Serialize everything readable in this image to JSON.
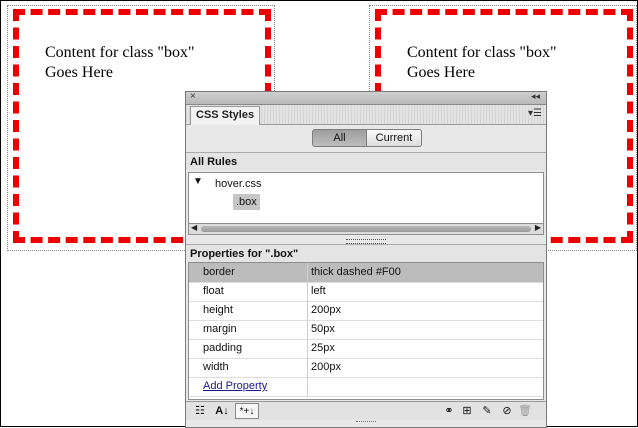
{
  "boxes": [
    {
      "line1": "Content for class \"box\"",
      "line2": "Goes Here"
    },
    {
      "line1": "Content for class \"box\"",
      "line2": "Goes Here"
    }
  ],
  "panel": {
    "tab_label": "CSS Styles",
    "close_glyph": "×",
    "collapse_glyph": "◂◂",
    "menu_glyph": "▾☰",
    "toggle": {
      "all_label": "All",
      "current_label": "Current",
      "selected": "All"
    },
    "rules_header": "All Rules",
    "rules": {
      "file": "hover.css",
      "selected_rule": ".box"
    },
    "properties_header": "Properties for \".box\"",
    "properties": [
      {
        "name": "border",
        "value": "thick dashed #F00"
      },
      {
        "name": "float",
        "value": "left"
      },
      {
        "name": "height",
        "value": "200px"
      },
      {
        "name": "margin",
        "value": "50px"
      },
      {
        "name": "padding",
        "value": "25px"
      },
      {
        "name": "width",
        "value": "200px"
      }
    ],
    "add_property_label": "Add Property",
    "toolbar": {
      "category_view": "☷",
      "alpha_view": "A↓",
      "set_props_view": "*+↓",
      "attach": "⚭",
      "new_rule": "⊞",
      "edit": "✎",
      "disable": "⊘",
      "delete": "🗑"
    }
  },
  "colors": {
    "box_border": "#FF0000",
    "selected_row": "#BCBCBC"
  }
}
